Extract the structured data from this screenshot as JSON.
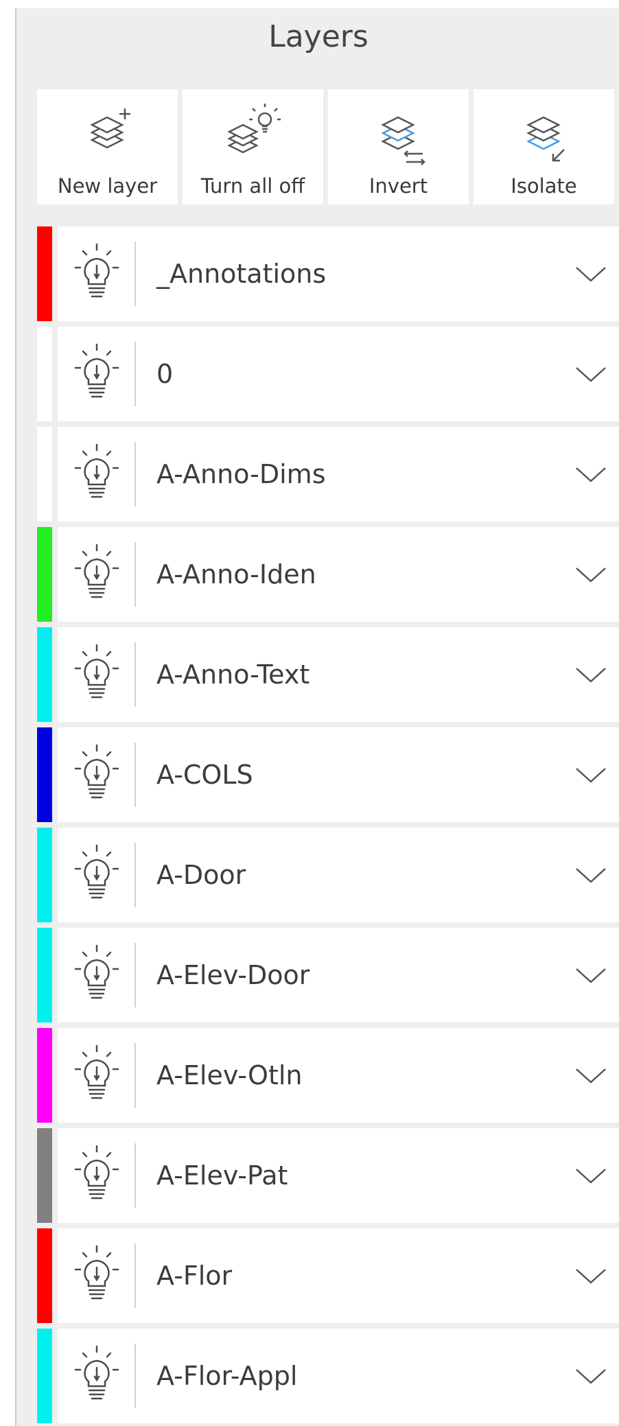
{
  "panel": {
    "title": "Layers"
  },
  "toolbar": [
    {
      "label": "New layer",
      "icon": "layers-add-icon"
    },
    {
      "label": "Turn all off",
      "icon": "layers-bulb-icon"
    },
    {
      "label": "Invert",
      "icon": "layers-invert-icon"
    },
    {
      "label": "Isolate",
      "icon": "layers-isolate-icon"
    }
  ],
  "layers": [
    {
      "name": "_Annotations",
      "color": "#ff0000"
    },
    {
      "name": "0",
      "color": "#ffffff"
    },
    {
      "name": "A-Anno-Dims",
      "color": "#ffffff"
    },
    {
      "name": "A-Anno-Iden",
      "color": "#22ee22"
    },
    {
      "name": "A-Anno-Text",
      "color": "#00f0f0"
    },
    {
      "name": "A-COLS",
      "color": "#0000e0"
    },
    {
      "name": "A-Door",
      "color": "#00f0f0"
    },
    {
      "name": "A-Elev-Door",
      "color": "#00f0f0"
    },
    {
      "name": "A-Elev-Otln",
      "color": "#ff00ff"
    },
    {
      "name": "A-Elev-Pat",
      "color": "#808080"
    },
    {
      "name": "A-Flor",
      "color": "#ff0000"
    },
    {
      "name": "A-Flor-Appl",
      "color": "#00f0f0"
    }
  ],
  "icons": {
    "visibility": "lightbulb-icon",
    "expand": "chevron-down-icon"
  }
}
